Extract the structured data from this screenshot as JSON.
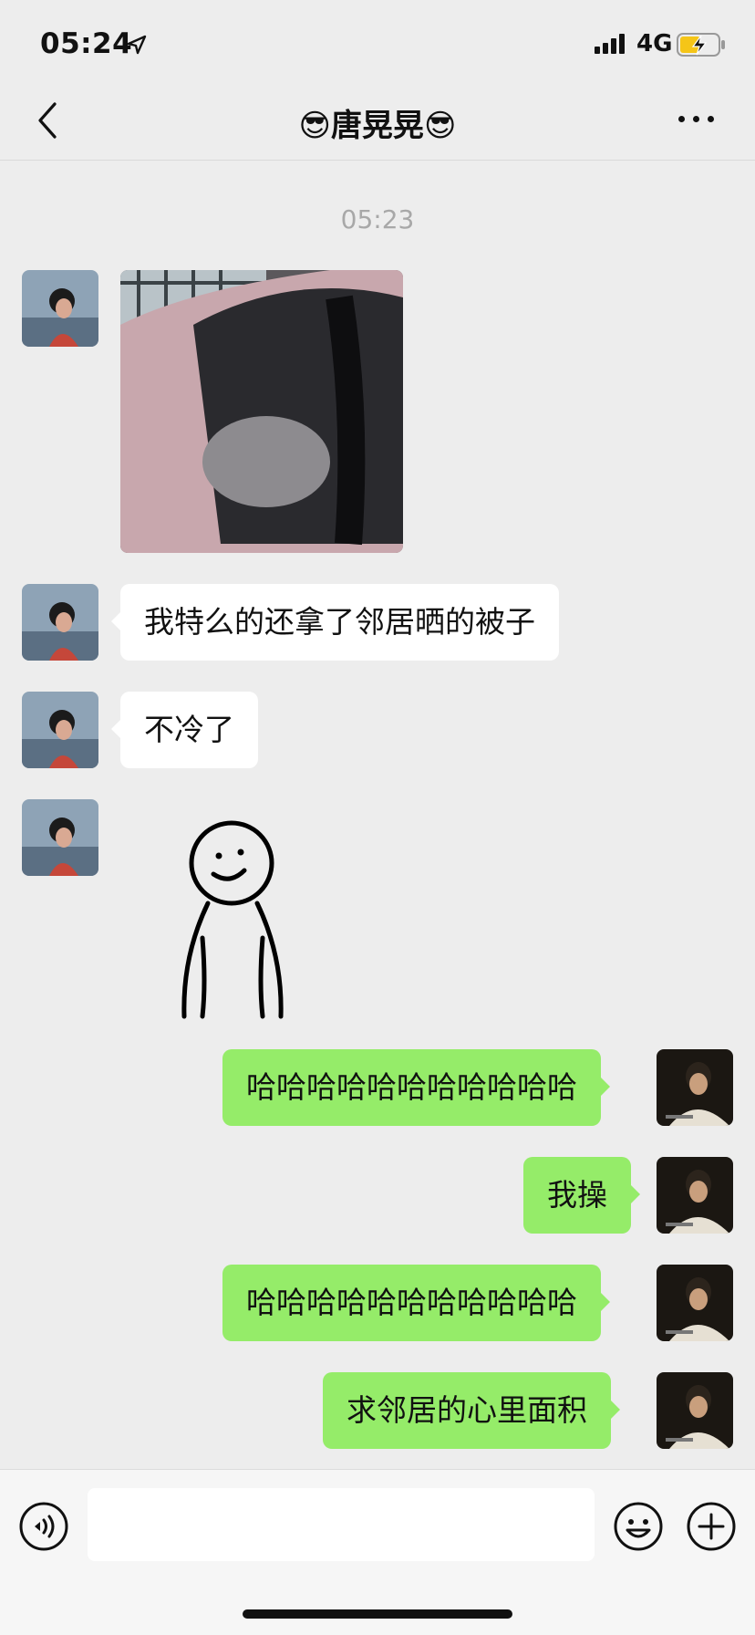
{
  "status_bar": {
    "time": "05:24",
    "network": "4G",
    "icons": [
      "location-arrow-icon",
      "cellular-signal-icon",
      "battery-charging-icon"
    ]
  },
  "nav": {
    "title": "😎唐晃晃😎",
    "back_icon": "chevron-left-icon",
    "more_icon": "ellipsis-icon"
  },
  "chat": {
    "timestamp": "05:23",
    "incoming": [
      {
        "type": "image"
      },
      {
        "type": "text",
        "text": "我特么的还拿了邻居晒的被子"
      },
      {
        "type": "text",
        "text": "不冷了"
      },
      {
        "type": "sticker"
      }
    ],
    "outgoing": [
      {
        "type": "text",
        "text": "哈哈哈哈哈哈哈哈哈哈哈"
      },
      {
        "type": "text",
        "text": "我操"
      },
      {
        "type": "text",
        "text": "哈哈哈哈哈哈哈哈哈哈哈"
      },
      {
        "type": "text",
        "text": "求邻居的心里面积"
      }
    ]
  },
  "input_bar": {
    "placeholder": "",
    "icons": [
      "voice-icon",
      "emoji-icon",
      "plus-icon"
    ]
  },
  "colors": {
    "background": "#ededed",
    "outgoing_bubble": "#95ec69",
    "incoming_bubble": "#ffffff",
    "timestamp_text": "#a8a8a8",
    "battery_fill": "#f5c518"
  }
}
